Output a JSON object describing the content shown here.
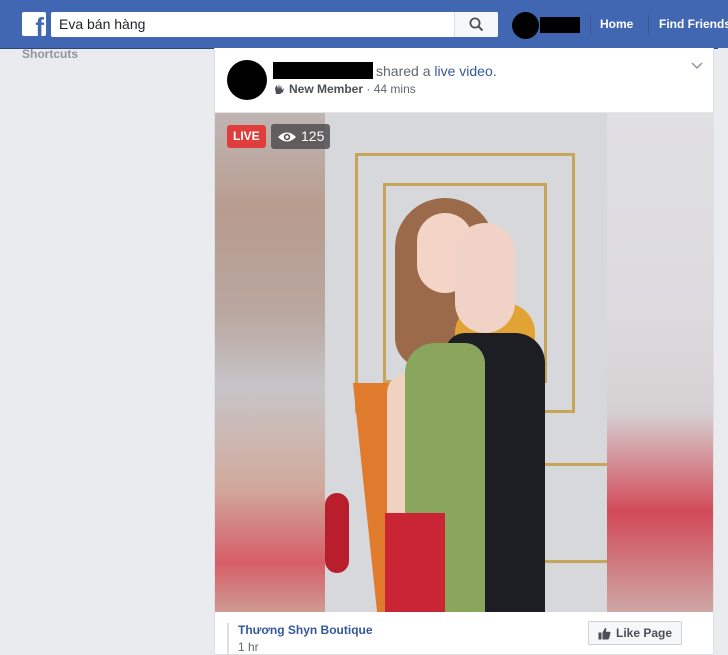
{
  "topbar": {
    "logo_letter": "f",
    "search_value": "Eva bán hàng",
    "nav_home": "Home",
    "nav_find_friends": "Find Friends"
  },
  "sidebar": {
    "shortcuts_label": "Shortcuts"
  },
  "post": {
    "action_text": "shared a",
    "action_link": "live video.",
    "badge": "New Member",
    "separator": "·",
    "time": "44 mins",
    "live_label": "LIVE",
    "viewer_count": "125"
  },
  "footer": {
    "page_name": "Thương Shyn Boutique",
    "page_time": "1 hr",
    "like_page_label": "Like Page"
  },
  "colors": {
    "topbar": "#4267b2",
    "live": "#e03d3d",
    "link": "#365899"
  }
}
